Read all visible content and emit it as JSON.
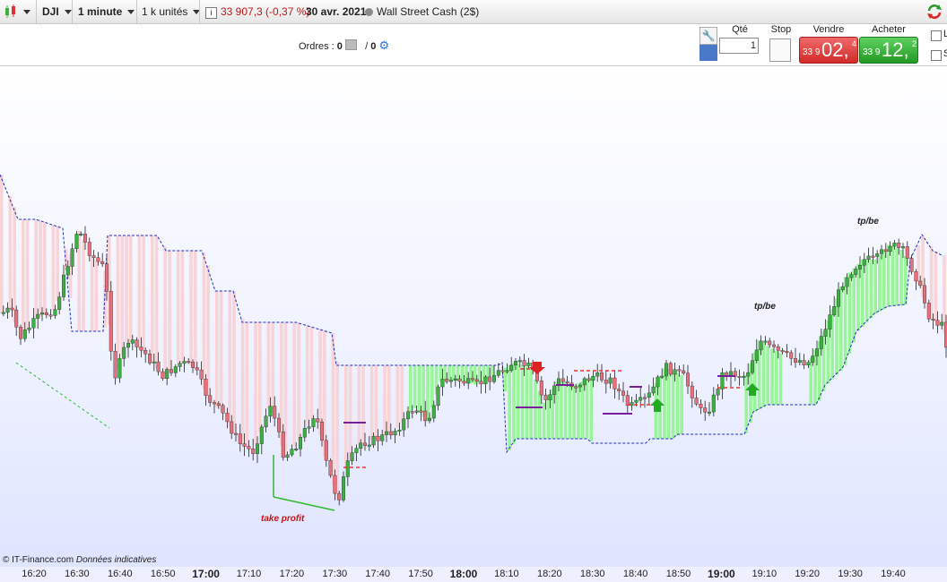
{
  "toolbar": {
    "symbol": "DJI",
    "timeframe": "1 minute",
    "units": "1 k unités",
    "info_icon": "info-icon",
    "price_change": "33 907,3 (-0,37 %)",
    "date": "30 avr. 2021",
    "instrument": "Wall Street Cash (2$)"
  },
  "orders": {
    "label": "Ordres :",
    "count_a": "0",
    "separator": "/",
    "count_b": "0"
  },
  "trade": {
    "qty_label": "Qté",
    "qty_value": "1",
    "stop_label": "Stop",
    "sell_label": "Vendre",
    "buy_label": "Acheter",
    "sell_small": "33 9",
    "sell_big": "02,",
    "sell_sup": "4",
    "buy_small": "33 9",
    "buy_big": "12,",
    "buy_sup": "2",
    "check1": "L",
    "check2": "S"
  },
  "chart": {
    "credit_source": "© IT-Finance.com",
    "credit_note": "Données indicatives",
    "annotations": [
      "take profit",
      "tp/be",
      "tp/be"
    ],
    "x_ticks": [
      "16:20",
      "16:30",
      "16:40",
      "16:50",
      "17:00",
      "17:10",
      "17:20",
      "17:30",
      "17:40",
      "17:50",
      "18:00",
      "18:10",
      "18:20",
      "18:30",
      "18:40",
      "18:50",
      "19:00",
      "19:10",
      "19:20",
      "19:30",
      "19:40"
    ],
    "bold_ticks": [
      "17:00",
      "18:00",
      "19:00"
    ],
    "colors": {
      "up": "#3cb043",
      "down": "#e86f7c",
      "zone_red": "#f8d3d8",
      "zone_green": "#98f598",
      "stop_line": "#1f2fbf"
    }
  },
  "chart_data": {
    "type": "candlestick",
    "instrument": "DJI",
    "interval": "1 minute",
    "x_ticks": [
      "16:20",
      "16:30",
      "16:40",
      "16:50",
      "17:00",
      "17:10",
      "17:20",
      "17:30",
      "17:40",
      "17:50",
      "18:00",
      "18:10",
      "18:20",
      "18:30",
      "18:40",
      "18:50",
      "19:00",
      "19:10",
      "19:20",
      "19:30",
      "19:40"
    ],
    "annotations": [
      "take profit",
      "tp/be",
      "tp/be"
    ]
  }
}
